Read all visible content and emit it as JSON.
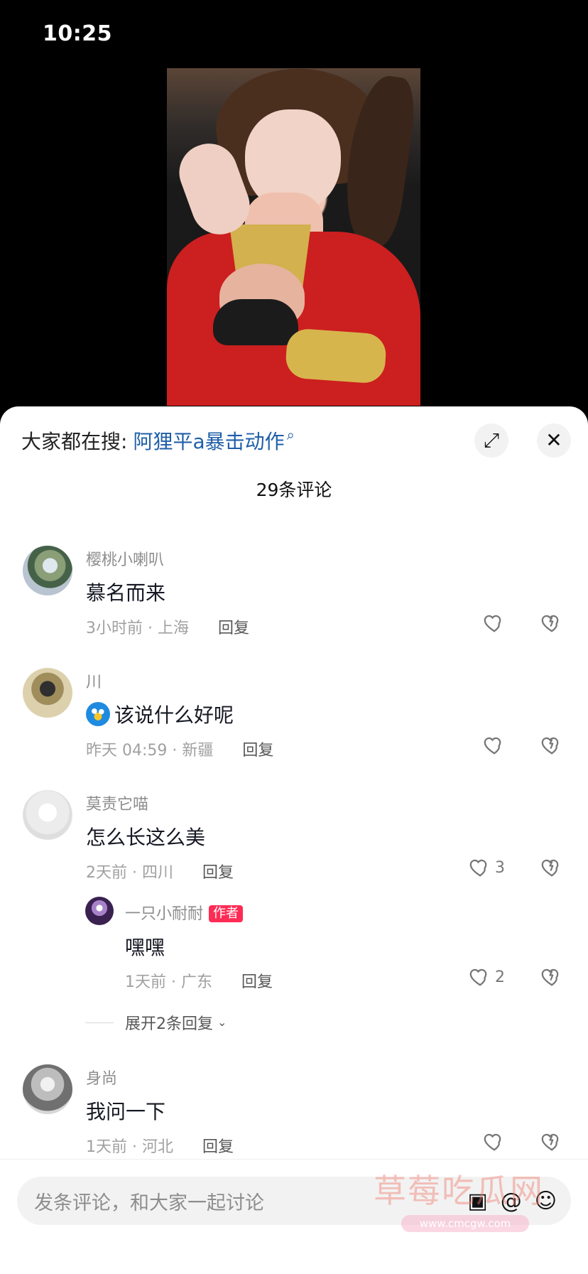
{
  "status_bar": {
    "time": "10:25"
  },
  "search_bar": {
    "label": "大家都在搜:",
    "query": "阿狸平a暴击动作"
  },
  "sheet": {
    "comment_count": "29条评论"
  },
  "comments": [
    {
      "username": "樱桃小喇叭",
      "text": "慕名而来",
      "meta": "3小时前 · 上海",
      "reply_label": "回复",
      "like_count": ""
    },
    {
      "username": "川",
      "text": "该说什么好呢",
      "meta": "昨天 04:59 · 新疆",
      "reply_label": "回复",
      "like_count": ""
    },
    {
      "username": "莫责它喵",
      "text": "怎么长这么美",
      "meta": "2天前 · 四川",
      "reply_label": "回复",
      "like_count": "3"
    },
    {
      "username": "一只小耐耐",
      "badge": "作者",
      "text": "嘿嘿",
      "meta": "1天前 · 广东",
      "reply_label": "回复",
      "like_count": "2"
    },
    {
      "username": "身尚",
      "text": "我问一下",
      "meta": "1天前 · 河北",
      "reply_label": "回复",
      "like_count": ""
    }
  ],
  "thread": {
    "expand_label": "展开2条回复"
  },
  "composer": {
    "placeholder": "发条评论，和大家一起讨论"
  },
  "watermark": {
    "main": "草莓吃瓜网",
    "url": "www.cmcgw.com"
  },
  "colors": {
    "accent": "#fe2c55",
    "link": "#1f5fa8",
    "text_primary": "#161823",
    "text_secondary": "#8d8d8d"
  },
  "icons": {
    "search": "search-icon",
    "expand": "expand-icon",
    "close": "close-icon",
    "heart": "heart-icon",
    "dislike": "dislike-heart-icon",
    "emoji": "emoji-icon",
    "mention": "mention-icon",
    "image": "image-icon"
  }
}
